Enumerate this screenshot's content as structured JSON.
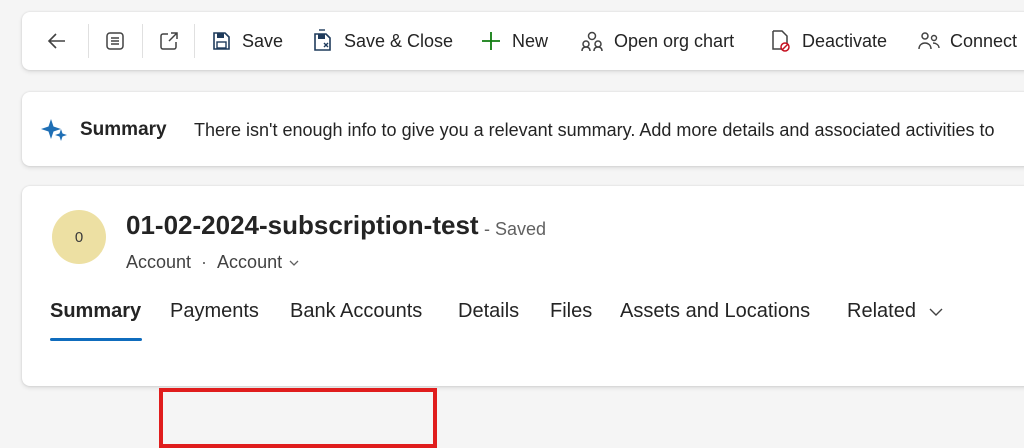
{
  "toolbar": {
    "back": "back-arrow",
    "save_label": "Save",
    "save_close_label": "Save & Close",
    "new_label": "New",
    "org_chart_label": "Open org chart",
    "deactivate_label": "Deactivate",
    "connect_label": "Connect"
  },
  "summary": {
    "title": "Summary",
    "text": "There isn't enough info to give you a relevant summary. Add more details and associated activities to"
  },
  "record": {
    "avatar_initial": "0",
    "title": "01-02-2024-subscription-test",
    "status": "- Saved",
    "entity": "Account",
    "separator": "·",
    "form": "Account"
  },
  "tabs": [
    {
      "label": "Summary"
    },
    {
      "label": "Payments"
    },
    {
      "label": "Bank Accounts"
    },
    {
      "label": "Details"
    },
    {
      "label": "Files"
    },
    {
      "label": "Assets and Locations"
    },
    {
      "label": "Related"
    }
  ],
  "colors": {
    "accent": "#0f6cbd",
    "highlight": "#e01d1d",
    "avatar_bg": "#ede0a3",
    "plus": "#107c10"
  }
}
